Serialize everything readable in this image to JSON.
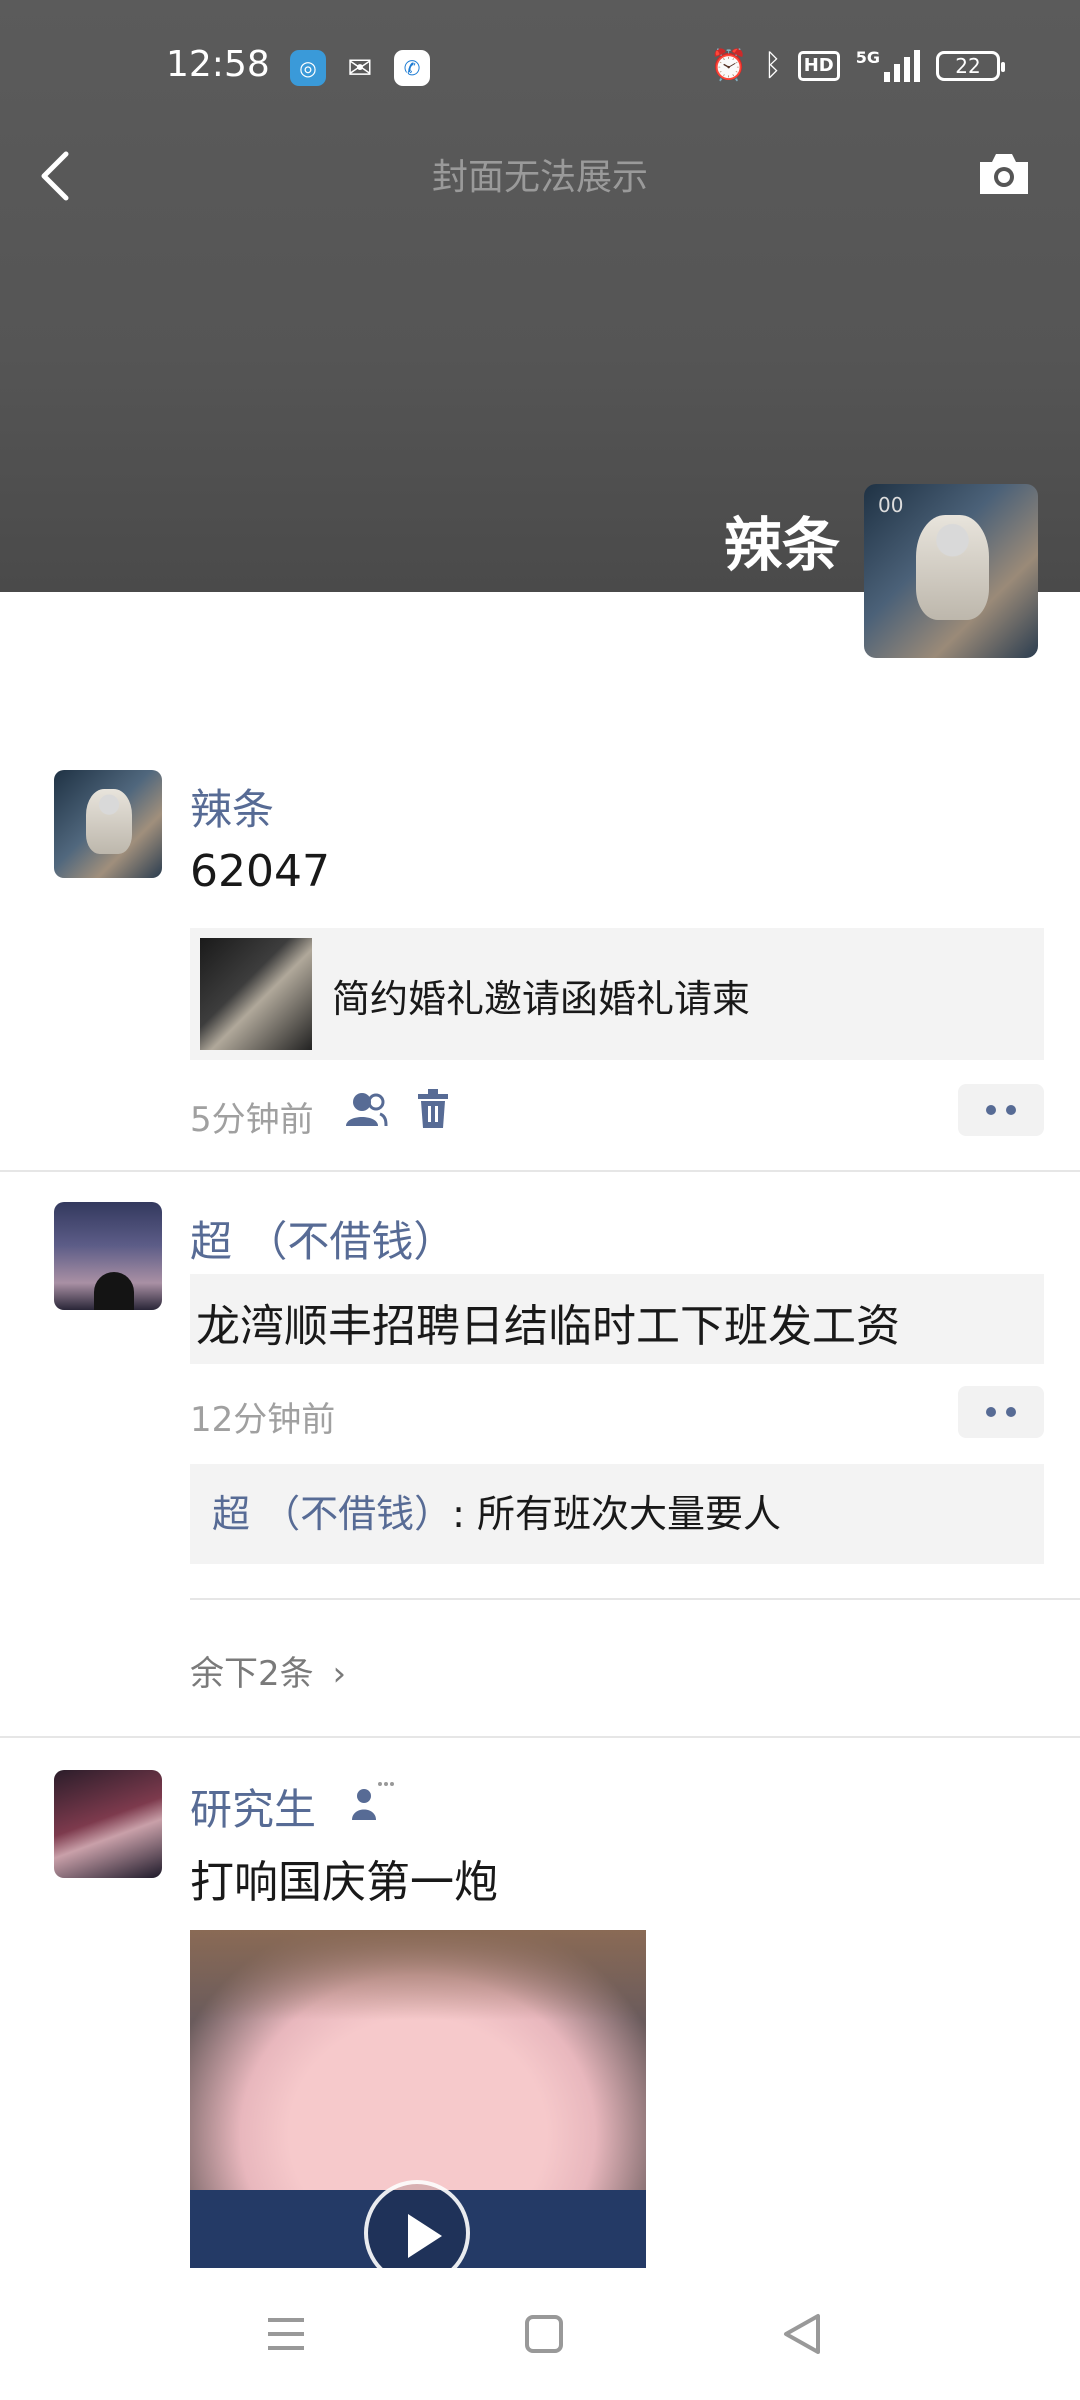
{
  "status_bar": {
    "time": "12:58",
    "network": "5G",
    "battery": "22",
    "hd_label": "HD"
  },
  "header": {
    "cover_title": "封面无法展示",
    "profile_name": "辣条",
    "avatar_tag": "00"
  },
  "posts": [
    {
      "author": "辣条",
      "text": "62047",
      "link_card": {
        "title": "简约婚礼邀请函婚礼请柬"
      },
      "time": "5分钟前"
    },
    {
      "author": "超  （不借钱）",
      "text": "龙湾顺丰招聘日结临时工下班发工资",
      "time": "12分钟前",
      "comment": {
        "author": "超  （不借钱）",
        "text": ": 所有班次大量要人"
      },
      "remaining": "余下2条"
    },
    {
      "author": "研究生",
      "text": "打响国庆第一炮"
    }
  ],
  "colors": {
    "author_blue": "#576b95",
    "cover_gray": "#555555"
  },
  "icons": [
    "back-icon",
    "camera-icon",
    "alarm-icon",
    "bluetooth-icon",
    "friends-icon",
    "trash-icon",
    "more-icon",
    "play-icon",
    "menu-icon",
    "home-icon",
    "back-triangle-icon"
  ]
}
